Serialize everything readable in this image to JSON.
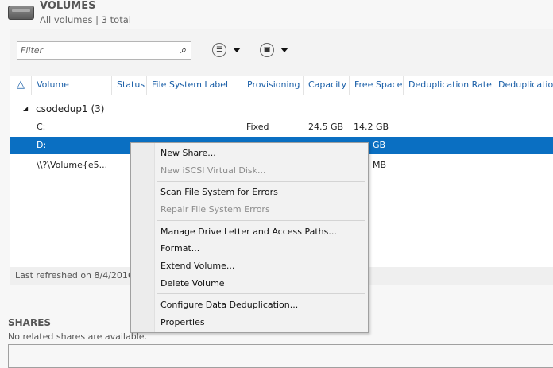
{
  "header": {
    "icon": "drive-icon",
    "title": "VOLUMES",
    "subtitle": "All volumes | 3 total"
  },
  "toolbar": {
    "filter_placeholder": "Filter",
    "search_icon": "search-icon",
    "view_icon": "list-options-icon",
    "save_icon": "save-icon"
  },
  "columns": [
    "Volume",
    "Status",
    "File System Label",
    "Provisioning",
    "Capacity",
    "Free Space",
    "Deduplication Rate",
    "Deduplication"
  ],
  "group": {
    "label": "csodedup1 (3)"
  },
  "rows": [
    {
      "volume": "C:",
      "provisioning": "Fixed",
      "capacity": "24.5 GB",
      "free": "14.2 GB"
    },
    {
      "volume": "D:",
      "free_partial": "GB",
      "selected": true
    },
    {
      "volume": "\\\\?\\Volume{e5...",
      "free_partial": "MB"
    }
  ],
  "footer": {
    "text": "Last refreshed on 8/4/2016"
  },
  "shares": {
    "title": "SHARES",
    "subtitle": "No related shares are available."
  },
  "menu": {
    "items": [
      {
        "label": "New Share..."
      },
      {
        "label": "New iSCSI Virtual Disk...",
        "disabled": true
      },
      {
        "label": "Scan File System for Errors"
      },
      {
        "label": "Repair File System Errors",
        "disabled": true
      },
      {
        "label": "Manage Drive Letter and Access Paths..."
      },
      {
        "label": "Format..."
      },
      {
        "label": "Extend Volume..."
      },
      {
        "label": "Delete Volume"
      },
      {
        "label": "Configure Data Deduplication..."
      },
      {
        "label": "Properties"
      }
    ]
  },
  "colors": {
    "selection": "#0a6fc2",
    "column_header": "#1a5fa8"
  }
}
